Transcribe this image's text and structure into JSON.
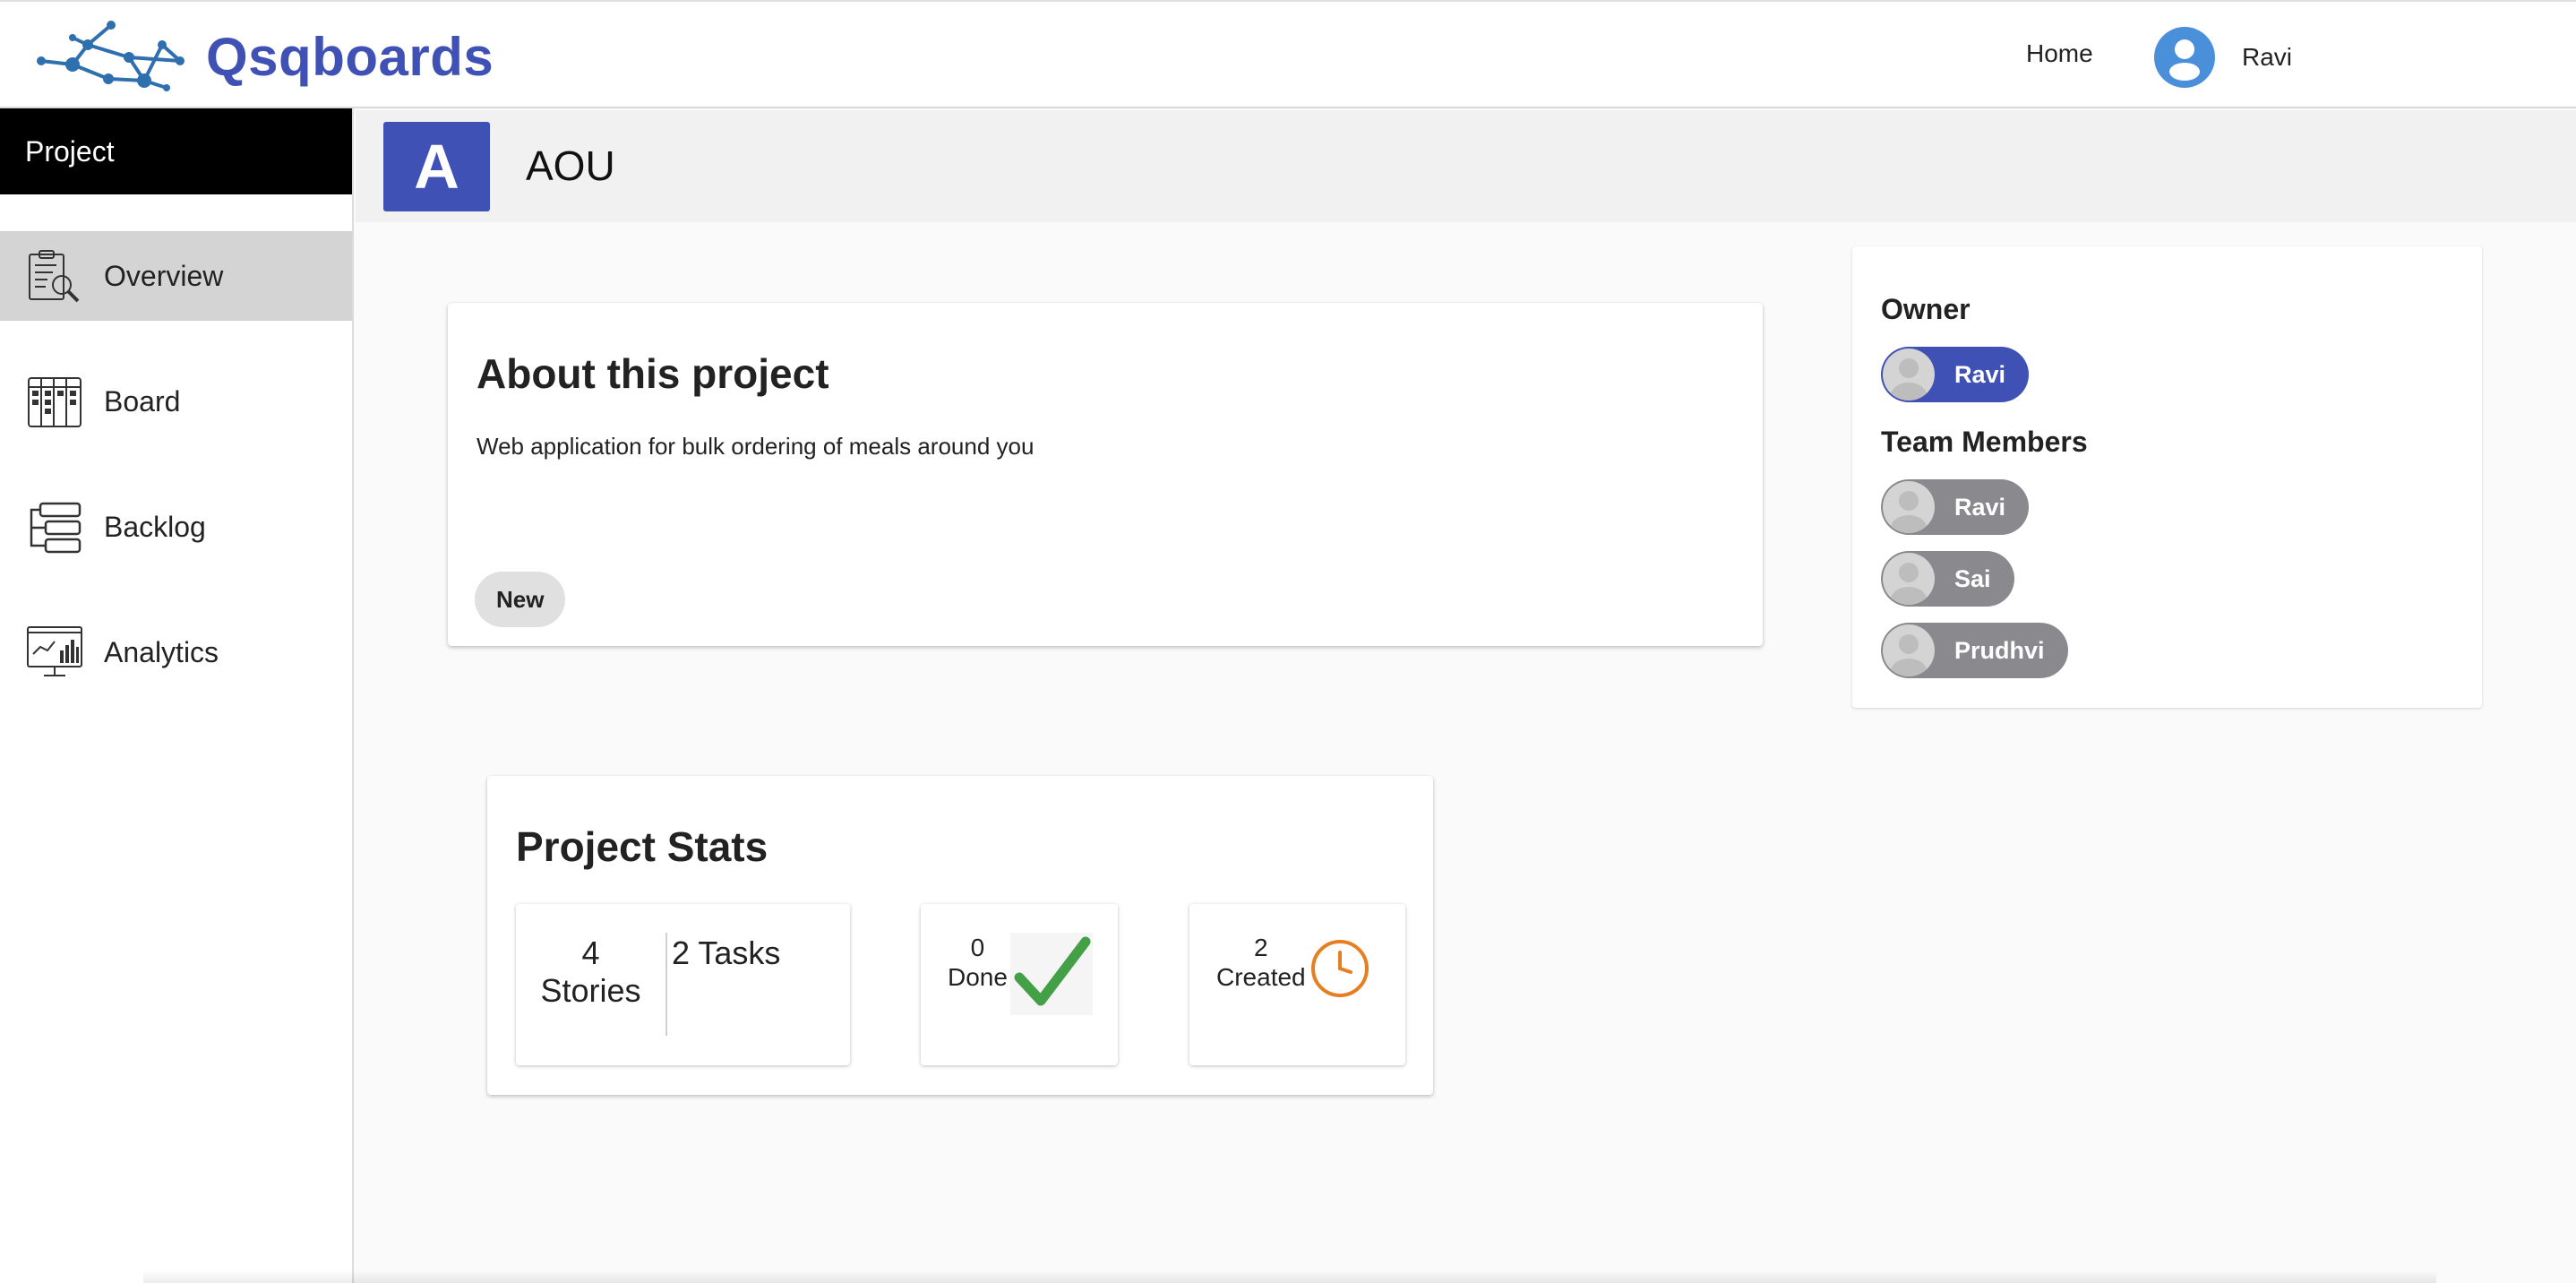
{
  "app": {
    "name": "Qsqboards"
  },
  "nav": {
    "home": "Home",
    "user_name": "Ravi"
  },
  "sidebar": {
    "header": "Project",
    "items": [
      {
        "label": "Overview",
        "icon": "clipboard-search-icon",
        "active": true
      },
      {
        "label": "Board",
        "icon": "board-icon",
        "active": false
      },
      {
        "label": "Backlog",
        "icon": "backlog-icon",
        "active": false
      },
      {
        "label": "Analytics",
        "icon": "analytics-icon",
        "active": false
      }
    ]
  },
  "project": {
    "initial": "A",
    "name": "AOU"
  },
  "about": {
    "title": "About this project",
    "description": "Web application for bulk ordering of meals around you",
    "status": "New"
  },
  "people": {
    "owner_label": "Owner",
    "owner": "Ravi",
    "members_label": "Team Members",
    "members": [
      "Ravi",
      "Sai",
      "Prudhvi"
    ]
  },
  "stats": {
    "title": "Project Stats",
    "stories_count": "4",
    "stories_label": "Stories",
    "tasks": "2 Tasks",
    "done_count": "0",
    "done_label": "Done",
    "created_count": "2",
    "created_label": "Created"
  },
  "colors": {
    "brand": "#3f51b5",
    "member_chip": "#8a8a8e",
    "done_check": "#43a047",
    "created_clock": "#e67e22"
  }
}
